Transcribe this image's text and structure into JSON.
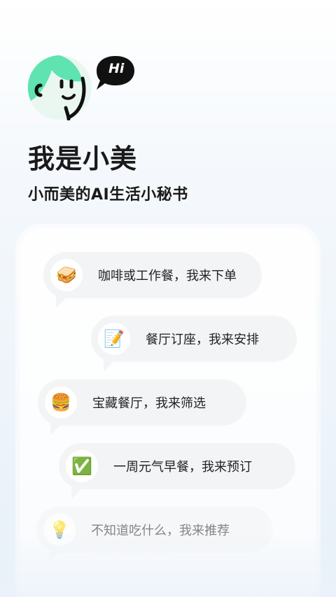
{
  "header": {
    "greeting": "Hi",
    "title": "我是小美",
    "subtitle": "小而美的AI生活小秘书"
  },
  "features": [
    {
      "icon": "sandwich-icon",
      "emoji": "🥪",
      "text": "咖啡或工作餐，我来下单"
    },
    {
      "icon": "memo-icon",
      "emoji": "📝",
      "text": "餐厅订座，我来安排"
    },
    {
      "icon": "burger-icon",
      "emoji": "🍔",
      "text": "宝藏餐厅，我来筛选"
    },
    {
      "icon": "check-mark-icon",
      "emoji": "✅",
      "text": "一周元气早餐，我来预订"
    },
    {
      "icon": "light-bulb-icon",
      "emoji": "💡",
      "text": "不知道吃什么，我来推荐"
    }
  ],
  "colors": {
    "brand_green": "#5ee3b1",
    "text_dark": "#1a1a1a",
    "bubble_bg": "#f3f4f6"
  }
}
